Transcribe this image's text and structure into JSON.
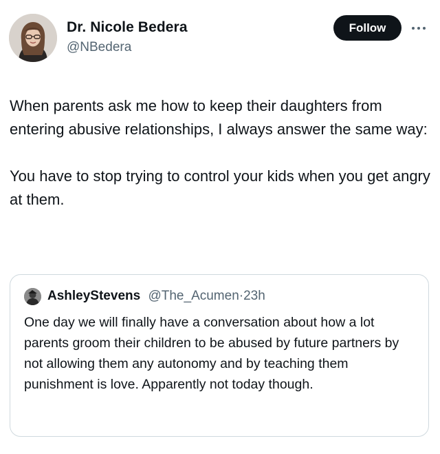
{
  "post": {
    "author": {
      "name": "Dr. Nicole Bedera",
      "handle": "@NBedera"
    },
    "follow_label": "Follow",
    "paragraphs": [
      "When parents ask me how to keep their daughters from entering abusive relationships, I always answer the same way:",
      "You have to stop trying to control your kids when you get angry at them."
    ],
    "icons": {
      "avatar": "profile-photo",
      "more": "more-options-icon"
    }
  },
  "quote": {
    "author_name": "AshleyStevens",
    "handle": "@The_Acumen",
    "separator": "·",
    "time": "23h",
    "text": "One day we will finally have a conversation about how a lot parents groom their children to be abused by future partners by not allowing them any autonomy and by teaching them punishment is love. Apparently not today though."
  },
  "colors": {
    "text_primary": "#0f1419",
    "text_secondary": "#536471",
    "follow_button_bg": "#0f1419",
    "follow_button_text": "#ffffff",
    "card_border": "#cfd9de"
  }
}
